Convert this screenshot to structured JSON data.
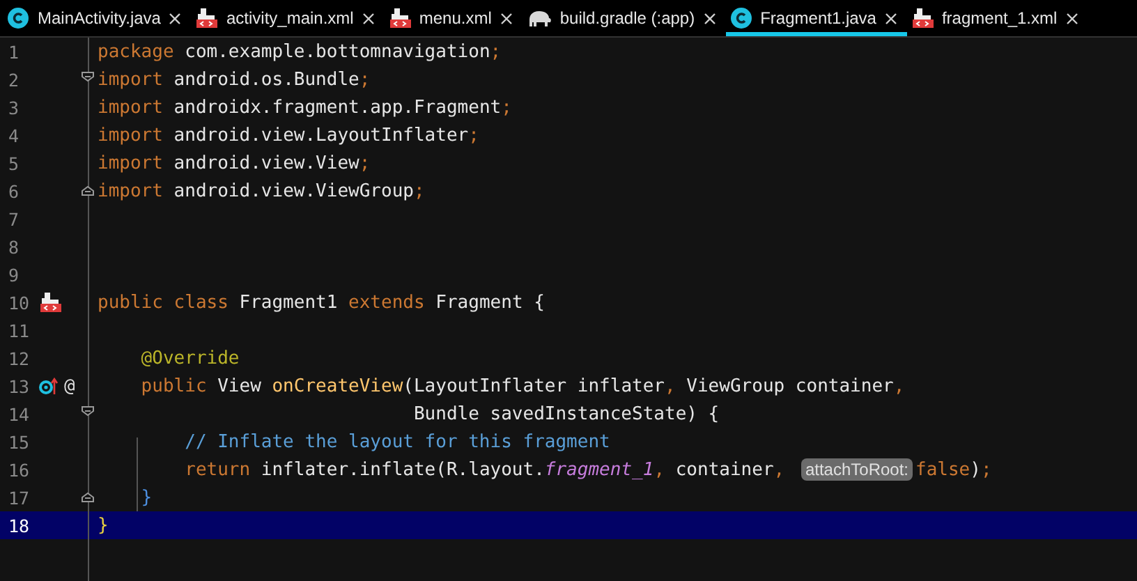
{
  "tabs": [
    {
      "label": "MainActivity.java",
      "kind": "class",
      "selected": false
    },
    {
      "label": "activity_main.xml",
      "kind": "xml",
      "selected": false
    },
    {
      "label": "menu.xml",
      "kind": "xml",
      "selected": false
    },
    {
      "label": "build.gradle (:app)",
      "kind": "gradle",
      "selected": false
    },
    {
      "label": "Fragment1.java",
      "kind": "class",
      "selected": true
    },
    {
      "label": "fragment_1.xml",
      "kind": "xml",
      "selected": false
    }
  ],
  "editor": {
    "lines": [
      {
        "number": "1",
        "current": false,
        "fold_start": false,
        "fold_end": false,
        "parts": [
          {
            "kind": "code",
            "tokens": [
              {
                "kind": "keyword",
                "text": "package "
              },
              {
                "kind": "plain",
                "text": "com.example.bottomnavigation"
              },
              {
                "kind": "keyword",
                "text": ";"
              }
            ]
          }
        ]
      },
      {
        "number": "2",
        "current": false,
        "fold_start": true,
        "fold_end": false,
        "parts": [
          {
            "kind": "code",
            "tokens": [
              {
                "kind": "keyword",
                "text": "import "
              },
              {
                "kind": "plain",
                "text": "android.os.Bundle"
              },
              {
                "kind": "keyword",
                "text": ";"
              }
            ]
          }
        ]
      },
      {
        "number": "3",
        "current": false,
        "fold_start": false,
        "fold_end": false,
        "parts": [
          {
            "kind": "code",
            "tokens": [
              {
                "kind": "keyword",
                "text": "import "
              },
              {
                "kind": "plain",
                "text": "androidx.fragment.app.Fragment"
              },
              {
                "kind": "keyword",
                "text": ";"
              }
            ]
          }
        ]
      },
      {
        "number": "4",
        "current": false,
        "fold_start": false,
        "fold_end": false,
        "parts": [
          {
            "kind": "code",
            "tokens": [
              {
                "kind": "keyword",
                "text": "import "
              },
              {
                "kind": "plain",
                "text": "android.view.LayoutInflater"
              },
              {
                "kind": "keyword",
                "text": ";"
              }
            ]
          }
        ]
      },
      {
        "number": "5",
        "current": false,
        "fold_start": false,
        "fold_end": false,
        "parts": [
          {
            "kind": "code",
            "tokens": [
              {
                "kind": "keyword",
                "text": "import "
              },
              {
                "kind": "plain",
                "text": "android.view.View"
              },
              {
                "kind": "keyword",
                "text": ";"
              }
            ]
          }
        ]
      },
      {
        "number": "6",
        "current": false,
        "fold_start": false,
        "fold_end": true,
        "parts": [
          {
            "kind": "code",
            "tokens": [
              {
                "kind": "keyword",
                "text": "import "
              },
              {
                "kind": "plain",
                "text": "android.view.ViewGroup"
              },
              {
                "kind": "keyword",
                "text": ";"
              }
            ]
          }
        ]
      },
      {
        "number": "7",
        "current": false,
        "fold_start": false,
        "fold_end": false
      },
      {
        "number": "8",
        "current": false,
        "fold_start": false,
        "fold_end": false
      },
      {
        "number": "9",
        "current": false,
        "fold_start": false,
        "fold_end": false
      },
      {
        "number": "10",
        "current": false,
        "fold_start": false,
        "fold_end": false,
        "markers": [
          {
            "kind": "layout"
          }
        ],
        "parts": [
          {
            "kind": "code",
            "tokens": [
              {
                "kind": "keyword",
                "text": "public class "
              },
              {
                "kind": "plain",
                "text": "Fragment1 "
              },
              {
                "kind": "keyword",
                "text": "extends "
              },
              {
                "kind": "plain",
                "text": "Fragment {"
              }
            ]
          }
        ]
      },
      {
        "number": "11",
        "current": false,
        "fold_start": false,
        "fold_end": false
      },
      {
        "number": "12",
        "current": false,
        "fold_start": false,
        "fold_end": false,
        "parts": [
          {
            "kind": "code",
            "tokens": [
              {
                "kind": "annotation",
                "text": "    @Override"
              }
            ]
          }
        ]
      },
      {
        "number": "13",
        "current": false,
        "fold_start": false,
        "fold_end": false,
        "markers": [
          {
            "kind": "override"
          },
          {
            "kind": "text",
            "text": "@"
          }
        ],
        "parts": [
          {
            "kind": "code",
            "tokens": [
              {
                "kind": "keyword",
                "text": "    public "
              },
              {
                "kind": "plain",
                "text": "View "
              },
              {
                "kind": "method",
                "text": "onCreateView"
              },
              {
                "kind": "plain",
                "text": "(LayoutInflater inflater"
              },
              {
                "kind": "keyword",
                "text": ", "
              },
              {
                "kind": "plain",
                "text": "ViewGroup container"
              },
              {
                "kind": "keyword",
                "text": ","
              }
            ]
          }
        ]
      },
      {
        "number": "14",
        "current": false,
        "fold_start": true,
        "fold_end": false,
        "parts": [
          {
            "kind": "code",
            "tokens": [
              {
                "kind": "plain",
                "text": "                             Bundle savedInstanceState) {"
              }
            ]
          }
        ]
      },
      {
        "number": "15",
        "current": false,
        "fold_start": false,
        "fold_end": false,
        "parts": [
          {
            "kind": "code",
            "tokens": [
              {
                "kind": "comment",
                "text": "        // Inflate the layout for this fragment"
              }
            ]
          }
        ]
      },
      {
        "number": "16",
        "current": false,
        "fold_start": false,
        "fold_end": false,
        "parts": [
          {
            "kind": "code",
            "tokens": [
              {
                "kind": "keyword",
                "text": "        return "
              },
              {
                "kind": "plain",
                "text": "inflater.inflate(R.layout."
              },
              {
                "kind": "field",
                "text": "fragment_1"
              },
              {
                "kind": "keyword",
                "text": ", "
              },
              {
                "kind": "plain",
                "text": "container"
              },
              {
                "kind": "keyword",
                "text": ", "
              }
            ]
          },
          {
            "kind": "hint",
            "text": "attachToRoot:"
          },
          {
            "kind": "code",
            "tokens": [
              {
                "kind": "keyword",
                "text": "false"
              },
              {
                "kind": "plain",
                "text": ")"
              },
              {
                "kind": "keyword",
                "text": ";"
              }
            ]
          }
        ]
      },
      {
        "number": "17",
        "current": false,
        "fold_start": false,
        "fold_end": true,
        "parts": [
          {
            "kind": "code",
            "tokens": [
              {
                "kind": "brace",
                "text": "    }"
              }
            ]
          }
        ]
      },
      {
        "number": "18",
        "current": true,
        "fold_start": false,
        "fold_end": false,
        "parts": [
          {
            "kind": "code",
            "tokens": [
              {
                "kind": "match",
                "text": "}"
              }
            ]
          }
        ]
      }
    ]
  }
}
